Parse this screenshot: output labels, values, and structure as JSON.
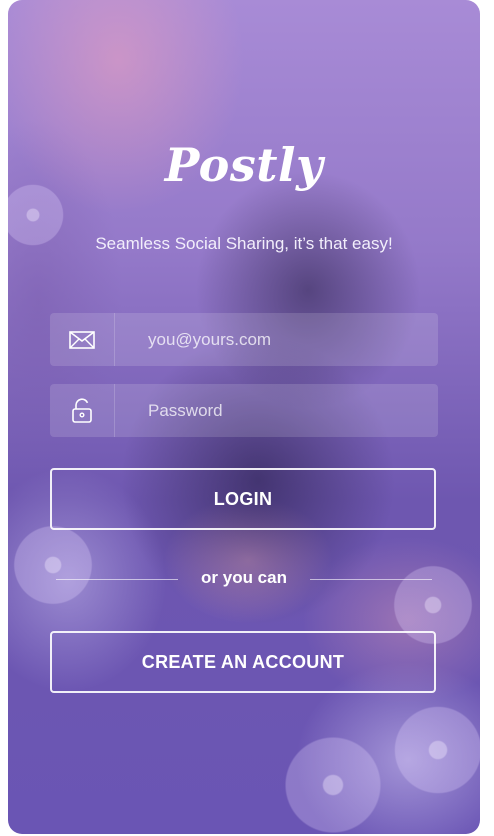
{
  "app": {
    "brand": "Postly",
    "tagline": "Seamless Social Sharing, it’s that easy!"
  },
  "form": {
    "email": {
      "placeholder": "you@yours.com",
      "value": "",
      "icon": "envelope-icon"
    },
    "password": {
      "placeholder": "Password",
      "value": "",
      "icon": "lock-icon"
    }
  },
  "buttons": {
    "login": "LOGIN",
    "create_account": "CREATE AN ACCOUNT"
  },
  "divider": {
    "text": "or you can"
  },
  "colors": {
    "accent": "#ffffff",
    "background_top": "#a88bd6",
    "background_bottom": "#6a55b4"
  }
}
